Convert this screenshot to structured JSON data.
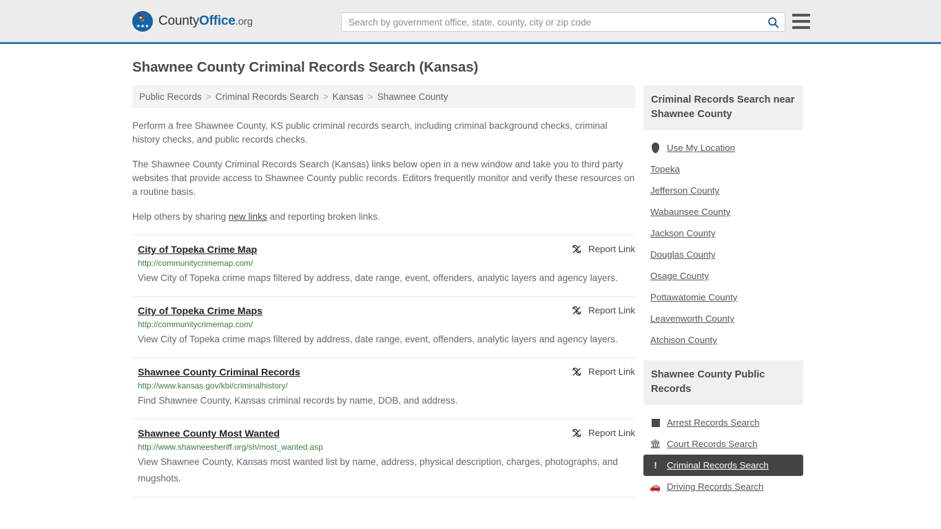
{
  "header": {
    "brand": {
      "part1": "County",
      "part2": "Office",
      "part3": ".org",
      "logo_icon": "eagle-seal-icon"
    },
    "search": {
      "placeholder": "Search by government office, state, county, city or zip code",
      "value": ""
    },
    "search_icon": "search-icon",
    "menu_icon": "hamburger-menu-icon"
  },
  "page": {
    "title": "Shawnee County Criminal Records Search (Kansas)"
  },
  "breadcrumb": {
    "items": [
      "Public Records",
      "Criminal Records Search",
      "Kansas",
      "Shawnee County"
    ],
    "separator": ">"
  },
  "intro": {
    "p1": "Perform a free Shawnee County, KS public criminal records search, including criminal background checks, criminal history checks, and public records checks.",
    "p2": "The Shawnee County Criminal Records Search (Kansas) links below open in a new window and take you to third party websites that provide access to Shawnee County public records. Editors frequently monitor and verify these resources on a routine basis.",
    "p3_before": "Help others by sharing ",
    "p3_link": "new links",
    "p3_after": " and reporting broken links."
  },
  "results": {
    "report_label": "Report Link",
    "report_icon": "broken-link-icon",
    "items": [
      {
        "title": "City of Topeka Crime Map",
        "url": "http://communitycrimemap.com/",
        "description": "View City of Topeka crime maps filtered by address, date range, event, offenders, analytic layers and agency layers."
      },
      {
        "title": "City of Topeka Crime Maps",
        "url": "http://communitycrimemap.com/",
        "description": "View City of Topeka crime maps filtered by address, date range, event, offenders, analytic layers and agency layers."
      },
      {
        "title": "Shawnee County Criminal Records",
        "url": "http://www.kansas.gov/kbi/criminalhistory/",
        "description": "Find Shawnee County, Kansas criminal records by name, DOB, and address."
      },
      {
        "title": "Shawnee County Most Wanted",
        "url": "http://www.shawneesheriff.org/sh/most_wanted.asp",
        "description": "View Shawnee County, Kansas most wanted list by name, address, physical description, charges, photographs, and mugshots."
      }
    ]
  },
  "sidebar": {
    "nearby": {
      "heading": "Criminal Records Search near Shawnee County",
      "use_my_location": {
        "label": "Use My Location",
        "icon": "map-pin-icon"
      },
      "links": [
        "Topeka",
        "Jefferson County",
        "Wabaunsee County",
        "Jackson County",
        "Douglas County",
        "Osage County",
        "Pottawatomie County",
        "Leavenworth County",
        "Atchison County"
      ]
    },
    "public_records": {
      "heading": "Shawnee County Public Records",
      "items": [
        {
          "label": "Arrest Records Search",
          "icon": "square-icon",
          "active": false
        },
        {
          "label": "Court Records Search",
          "icon": "courthouse-icon",
          "active": false
        },
        {
          "label": "Criminal Records Search",
          "icon": "exclamation-icon",
          "active": true
        },
        {
          "label": "Driving Records Search",
          "icon": "car-icon",
          "active": false
        }
      ]
    }
  },
  "colors": {
    "header_bg": "#ececec",
    "header_border": "#3c7cac",
    "brand_blue": "#1464a5",
    "url_green": "#3d7a3d",
    "panel_head_bg": "#f0f0f0",
    "active_bg": "#444444"
  }
}
